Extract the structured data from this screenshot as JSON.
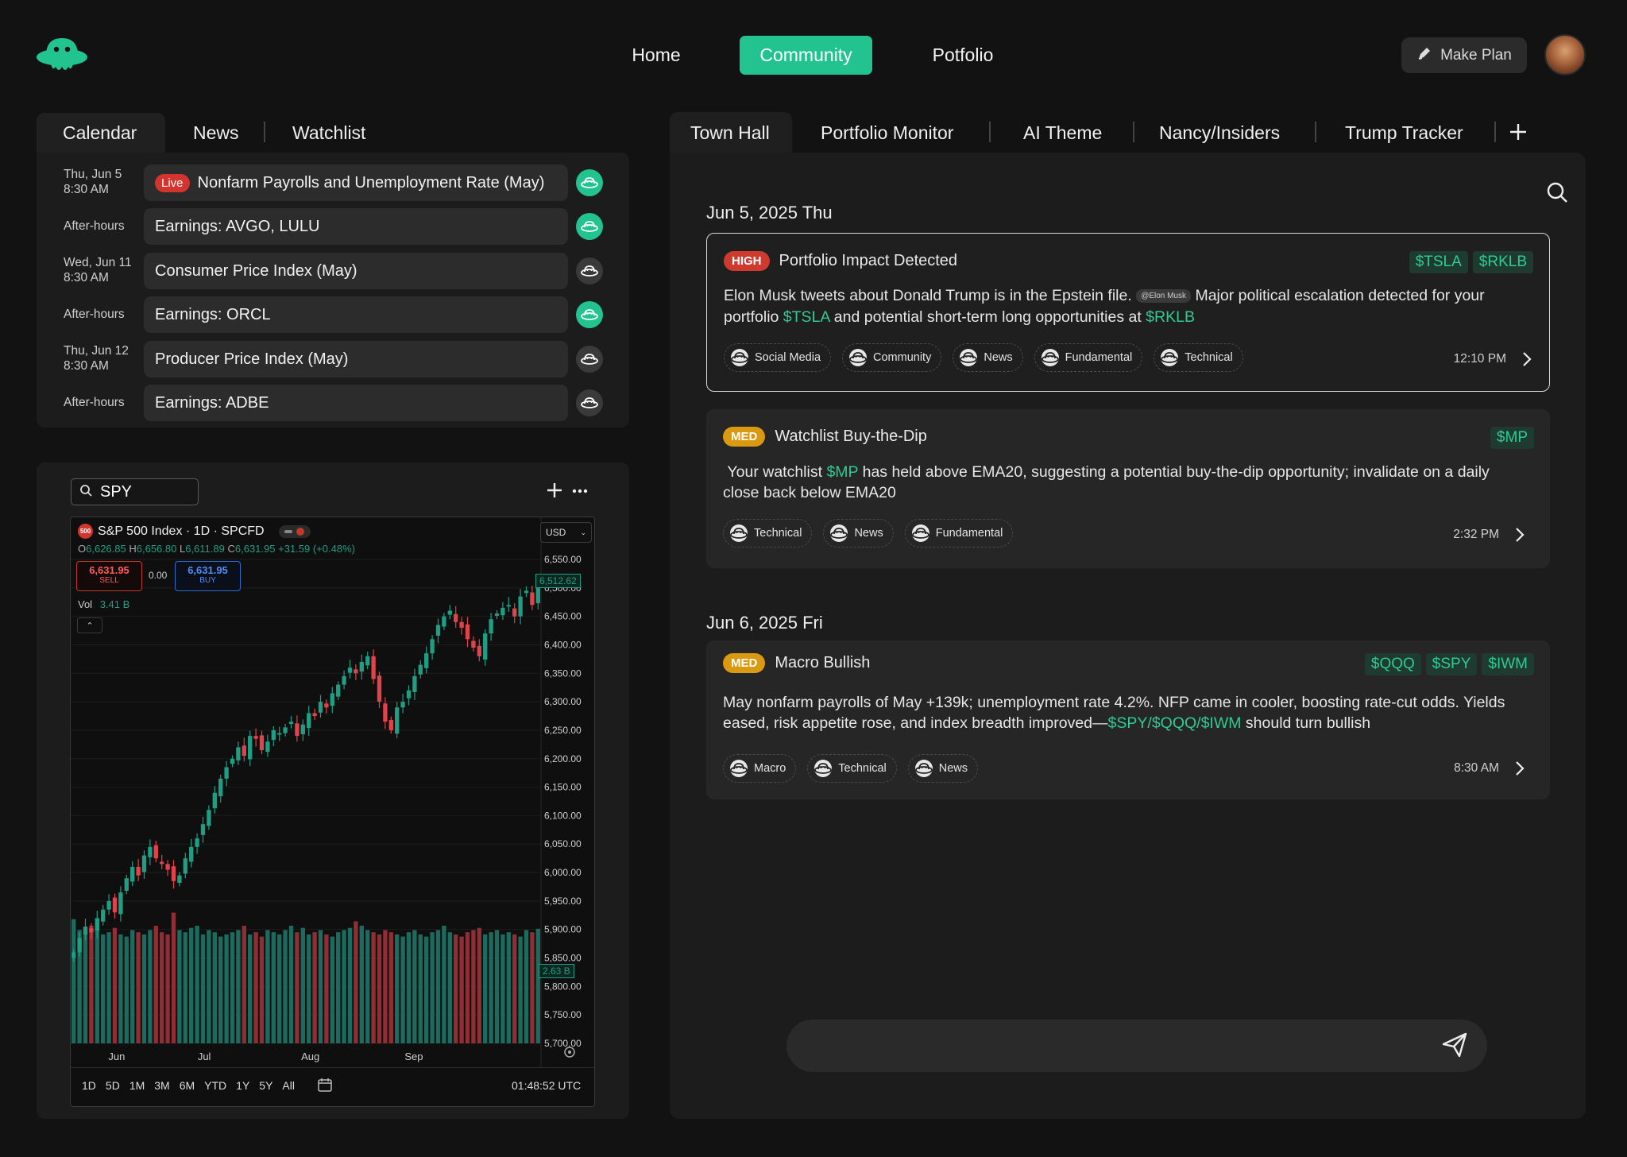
{
  "nav": {
    "home": "Home",
    "community": "Community",
    "portfolio": "Potfolio",
    "make_plan": "Make Plan"
  },
  "left_tabs": [
    "Calendar",
    "News",
    "Watchlist"
  ],
  "events": [
    {
      "date": "Thu, Jun 5",
      "time": "8:30 AM",
      "live": "Live",
      "title": "Nonfarm Payrolls and Unemployment Rate (May)",
      "icon": "green"
    },
    {
      "date": "After-hours",
      "time": "",
      "live": "",
      "title": "Earnings: AVGO, LULU",
      "icon": "green"
    },
    {
      "date": "Wed, Jun 11",
      "time": "8:30 AM",
      "live": "",
      "title": "Consumer Price Index (May)",
      "icon": "gray"
    },
    {
      "date": "After-hours",
      "time": "",
      "live": "",
      "title": "Earnings: ORCL",
      "icon": "green"
    },
    {
      "date": "Thu, Jun 12",
      "time": "8:30 AM",
      "live": "",
      "title": "Producer Price Index (May)",
      "icon": "gray"
    },
    {
      "date": "After-hours",
      "time": "",
      "live": "",
      "title": "Earnings: ADBE",
      "icon": "gray"
    }
  ],
  "chart": {
    "symbol": "SPY",
    "title": "S&P 500 Index · 1D · SPCFD",
    "badge": "500",
    "currency": "USD",
    "ohlc": {
      "o_label": "O",
      "o": "6,626.85",
      "h_label": "H",
      "h": "6,656.80",
      "l_label": "L",
      "l": "6,611.89",
      "c_label": "C",
      "c": "6,631.95",
      "chg": "+31.59 (+0.48%)"
    },
    "sell_price": "6,631.95",
    "sell_label": "SELL",
    "spread": "0.00",
    "buy_price": "6,631.95",
    "buy_label": "BUY",
    "vol_label": "Vol",
    "vol_value": "3.41 B",
    "price_tag": "6,512.62",
    "vol_tag": "2.63 B",
    "ranges": [
      "1D",
      "5D",
      "1M",
      "3M",
      "6M",
      "YTD",
      "1Y",
      "5Y",
      "All"
    ],
    "clock": "01:48:52 UTC",
    "colors": {
      "up": "#1f9e84",
      "down": "#e2424b",
      "up_vol": "#1d6b5e",
      "down_vol": "#8f2f35"
    }
  },
  "chart_data": {
    "type": "candlestick",
    "title": "S&P 500 Index · 1D · SPCFD",
    "x_ticks": [
      "Jun",
      "Jul",
      "Aug",
      "Sep"
    ],
    "y_ticks": [
      "6,550.00",
      "6,500.00",
      "6,450.00",
      "6,400.00",
      "6,350.00",
      "6,300.00",
      "6,250.00",
      "6,200.00",
      "6,150.00",
      "6,100.00",
      "6,050.00",
      "6,000.00",
      "5,950.00",
      "5,900.00",
      "5,850.00",
      "5,800.00",
      "5,750.00",
      "5,700.00"
    ],
    "ylim": [
      5700,
      6550
    ],
    "closes": [
      5860,
      5885,
      5905,
      5895,
      5920,
      5935,
      5950,
      5930,
      5965,
      5990,
      6010,
      5995,
      6030,
      6045,
      6025,
      6015,
      6005,
      5985,
      5995,
      6025,
      6045,
      6060,
      6085,
      6110,
      6140,
      6165,
      6185,
      6200,
      6220,
      6205,
      6240,
      6235,
      6215,
      6230,
      6250,
      6245,
      6255,
      6265,
      6240,
      6260,
      6280,
      6275,
      6300,
      6290,
      6315,
      6330,
      6345,
      6360,
      6350,
      6370,
      6380,
      6340,
      6300,
      6265,
      6250,
      6290,
      6300,
      6320,
      6345,
      6365,
      6385,
      6410,
      6435,
      6450,
      6460,
      6440,
      6430,
      6410,
      6395,
      6380,
      6420,
      6445,
      6455,
      6465,
      6470,
      6450,
      6485,
      6495,
      6470,
      6512
    ],
    "volumes_b": [
      2.85,
      2.6,
      2.55,
      2.7,
      2.6,
      2.5,
      2.55,
      2.65,
      2.5,
      2.45,
      2.6,
      2.55,
      2.5,
      2.6,
      2.7,
      2.55,
      2.5,
      3.0,
      2.6,
      2.55,
      2.65,
      2.7,
      2.5,
      2.6,
      2.55,
      2.45,
      2.5,
      2.55,
      2.6,
      2.7,
      2.5,
      2.55,
      2.45,
      2.6,
      2.55,
      2.5,
      2.6,
      2.7,
      2.55,
      2.65,
      2.5,
      2.55,
      2.6,
      2.5,
      2.45,
      2.55,
      2.6,
      2.65,
      2.8,
      2.7,
      2.6,
      2.55,
      2.5,
      2.6,
      2.55,
      2.5,
      2.45,
      2.55,
      2.6,
      2.5,
      2.45,
      2.55,
      2.6,
      2.7,
      2.55,
      2.5,
      2.45,
      2.55,
      2.6,
      2.65,
      2.5,
      2.55,
      2.6,
      2.5,
      2.55,
      2.5,
      2.45,
      2.6,
      2.55,
      2.63
    ]
  },
  "right_tabs": [
    "Town Hall",
    "Portfolio Monitor",
    "AI Theme",
    "Nancy/Insiders",
    "Trump Tracker"
  ],
  "feed": {
    "day1": "Jun 5, 2025 Thu",
    "day2": "Jun 6, 2025 Fri",
    "cards": [
      {
        "severity": "HIGH",
        "title": "Portfolio Impact Detected",
        "tickers": [
          "$TSLA",
          "$RKLB"
        ],
        "body_1": "Elon Musk tweets about Donald Trump is in the Epstein file.",
        "mention": "@Elon Musk",
        "body_2": "Major political escalation detected for your",
        "body_3": "portfolio",
        "body_t1": "$TSLA",
        "body_4": "and potential short-term long opportunities at",
        "body_t2": "$RKLB",
        "chips": [
          "Social Media",
          "Community",
          "News",
          "Fundamental",
          "Technical"
        ],
        "time": "12:10 PM"
      },
      {
        "severity": "MED",
        "title": "Watchlist Buy-the-Dip",
        "tickers": [
          "$MP"
        ],
        "body_1": "Your watchlist",
        "body_t1": "$MP",
        "body_2": "has held above EMA20, suggesting a potential buy-the-dip opportunity; invalidate on a daily",
        "body_3": "close back below EMA20",
        "chips": [
          "Technical",
          "News",
          "Fundamental"
        ],
        "time": "2:32 PM"
      },
      {
        "severity": "MED",
        "title": "Macro Bullish",
        "tickers": [
          "$QQQ",
          "$SPY",
          "$IWM"
        ],
        "body_1": "May nonfarm payrolls of May +139k; unemployment rate 4.2%. NFP came in cooler, boosting rate-cut odds. Yields",
        "body_2": "eased, risk appetite rose, and index breadth improved—",
        "body_t1": "$SPY/$QQQ/$IWM",
        "body_3": "should turn bullish",
        "chips": [
          "Macro",
          "Technical",
          "News"
        ],
        "time": "8:30 AM"
      }
    ]
  }
}
